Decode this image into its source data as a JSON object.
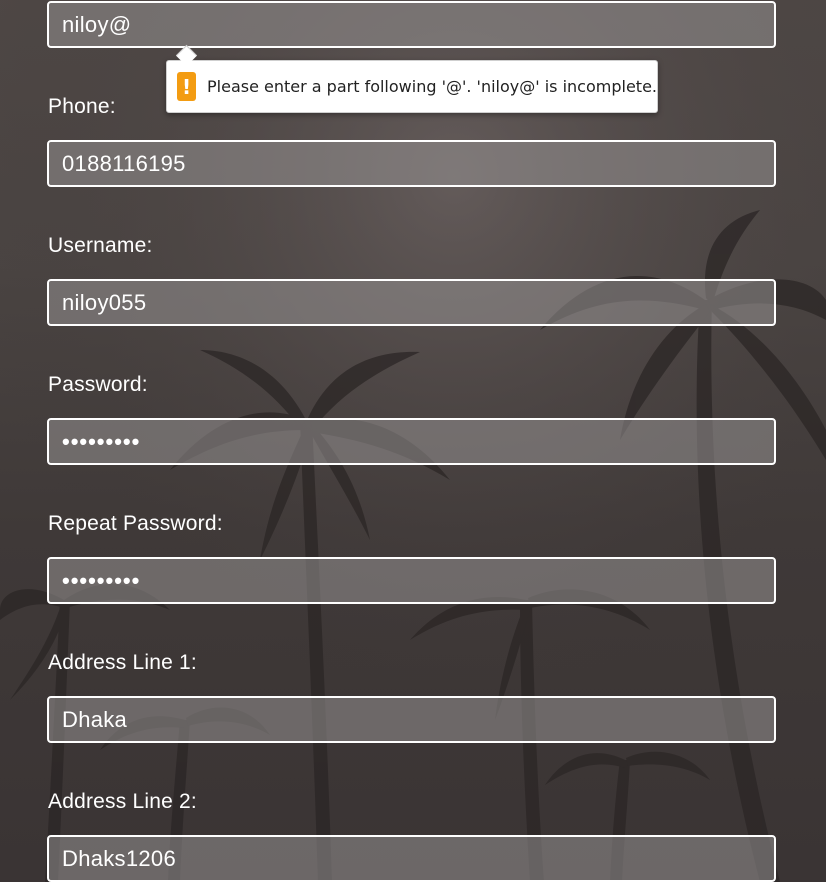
{
  "form": {
    "email": {
      "value": "niloy@"
    },
    "phone": {
      "label": "Phone:",
      "value": "0188116195"
    },
    "username": {
      "label": "Username:",
      "value": "niloy055"
    },
    "password": {
      "label": "Password:",
      "masked_value": "•••••••••"
    },
    "repeat_password": {
      "label": "Repeat Password:",
      "masked_value": "•••••••••"
    },
    "address_line_1": {
      "label": "Address Line 1:",
      "value": "Dhaka"
    },
    "address_line_2": {
      "label": "Address Line 2:",
      "value": "Dhaks1206"
    }
  },
  "validation_tooltip": {
    "icon": "warning-icon",
    "icon_glyph": "!",
    "message": "Please enter a part following '@'. 'niloy@' is incomplete.",
    "icon_color": "#f39c12"
  },
  "colors": {
    "field_border": "#ffffff",
    "text": "#ffffff"
  }
}
